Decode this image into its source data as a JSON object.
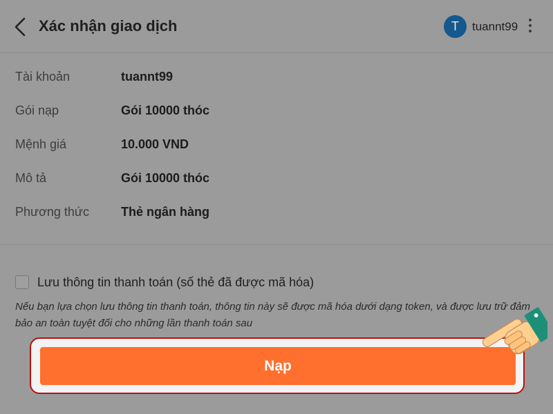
{
  "header": {
    "title": "Xác nhận giao dịch",
    "user": {
      "avatar_letter": "T",
      "name": "tuannt99"
    }
  },
  "details": [
    {
      "label": "Tài khoản",
      "value": "tuannt99"
    },
    {
      "label": "Gói nạp",
      "value": "Gói 10000 thóc"
    },
    {
      "label": "Mệnh giá",
      "value": "10.000 VND"
    },
    {
      "label": "Mô tả",
      "value": "Gói 10000 thóc"
    },
    {
      "label": "Phương thức",
      "value": "Thẻ ngân hàng"
    }
  ],
  "save_payment": {
    "label": "Lưu thông tin thanh toán (số thẻ đã được mã hóa)",
    "checked": false,
    "note": "Nếu bạn lựa chọn lưu thông tin thanh toán, thông tin này sẽ được mã hóa dưới dạng token, và được lưu trữ đảm bảo an toàn tuyệt đối cho những lần thanh toán sau"
  },
  "submit": {
    "label": "Nạp"
  },
  "colors": {
    "accent": "#ff6f2e",
    "avatar": "#14588d",
    "highlight_outline": "#b80f0f",
    "overlay_background": "#9b9b9b"
  },
  "icons": {
    "back": "chevron-left-icon",
    "more": "more-vertical-icon",
    "pointer": "pointing-hand-icon"
  }
}
